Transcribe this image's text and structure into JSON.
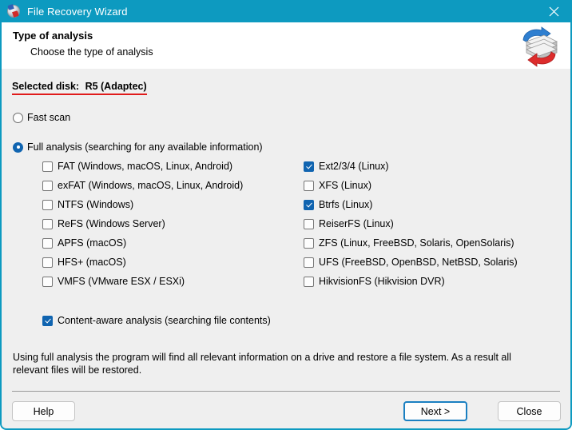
{
  "window": {
    "title": "File Recovery Wizard",
    "app_icon": "disk-recovery-icon",
    "close_icon": "close-icon",
    "titlebar_color": "#0d9ac0",
    "accent_color": "#1064b0",
    "underline_color": "#e01b1b"
  },
  "header": {
    "title": "Type of analysis",
    "subtitle": "Choose the type of analysis",
    "logo_icon": "disk-stack-recovery-logo"
  },
  "selected_disk": {
    "label": "Selected disk:",
    "value": "R5 (Adaptec)"
  },
  "scan_mode": {
    "options": [
      {
        "label": "Fast scan",
        "checked": false
      },
      {
        "label": "Full analysis (searching for any available information)",
        "checked": true
      }
    ]
  },
  "filesystems": {
    "left_column": [
      {
        "label": "FAT (Windows, macOS, Linux, Android)",
        "checked": false
      },
      {
        "label": "exFAT (Windows, macOS, Linux, Android)",
        "checked": false
      },
      {
        "label": "NTFS (Windows)",
        "checked": false
      },
      {
        "label": "ReFS (Windows Server)",
        "checked": false
      },
      {
        "label": "APFS (macOS)",
        "checked": false
      },
      {
        "label": "HFS+ (macOS)",
        "checked": false
      },
      {
        "label": "VMFS (VMware ESX / ESXi)",
        "checked": false
      }
    ],
    "right_column": [
      {
        "label": "Ext2/3/4 (Linux)",
        "checked": true
      },
      {
        "label": "XFS (Linux)",
        "checked": false
      },
      {
        "label": "Btrfs (Linux)",
        "checked": true
      },
      {
        "label": "ReiserFS (Linux)",
        "checked": false
      },
      {
        "label": "ZFS (Linux, FreeBSD, Solaris, OpenSolaris)",
        "checked": false
      },
      {
        "label": "UFS (FreeBSD, OpenBSD, NetBSD, Solaris)",
        "checked": false
      },
      {
        "label": "HikvisionFS (Hikvision DVR)",
        "checked": false
      }
    ]
  },
  "content_aware": {
    "label": "Content-aware analysis (searching file contents)",
    "checked": true
  },
  "description": "Using full analysis the program will find all relevant information on a drive and restore a file system. As a result all relevant files will be restored.",
  "buttons": {
    "help": "Help",
    "next": "Next >",
    "close": "Close"
  }
}
